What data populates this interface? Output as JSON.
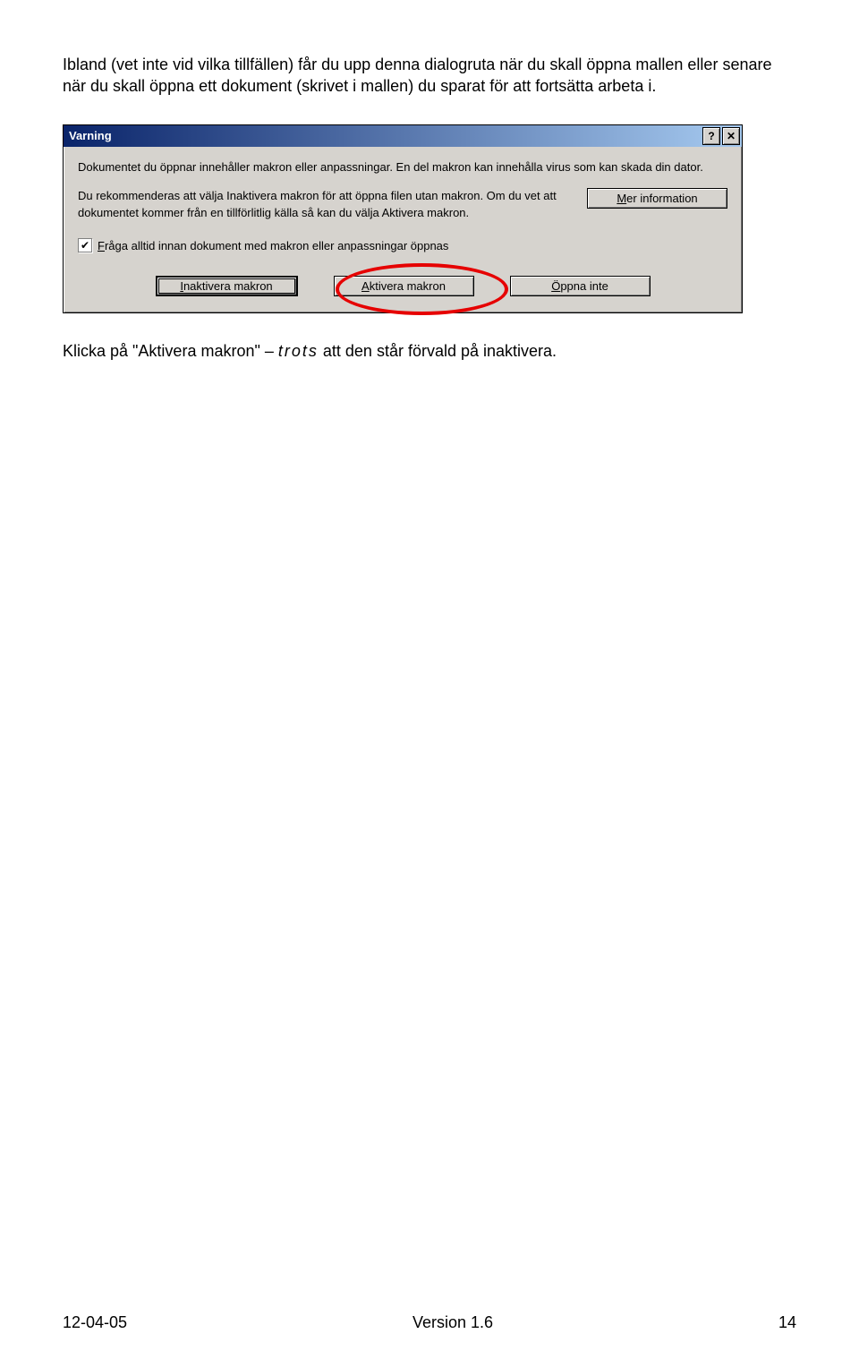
{
  "intro": "Ibland (vet inte vid vilka tillfällen) får du upp denna dialogruta när du skall öppna mallen eller senare när du skall öppna ett dokument (skrivet i mallen) du sparat för att fortsätta arbeta i.",
  "dialog": {
    "title": "Varning",
    "help_glyph": "?",
    "close_glyph": "✕",
    "para1": "Dokumentet du öppnar innehåller makron eller anpassningar. En del makron kan innehålla virus som kan skada din dator.",
    "para2": "Du rekommenderas att välja Inaktivera makron för att öppna filen utan makron. Om du vet att dokumentet kommer från en tillförlitlig källa så kan du välja Aktivera makron.",
    "more_info": "Mer information",
    "checkbox_check": "✔",
    "checkbox_label": "Fråga alltid innan dokument med makron eller anpassningar öppnas",
    "btn_disable": "Inaktivera makron",
    "btn_enable": "Aktivera makron",
    "btn_dont_open": "Öppna inte"
  },
  "outro_pre": "Klicka på \"Aktivera makron\" – ",
  "outro_em": "trots",
  "outro_post": " att den står förvald på inaktivera.",
  "footer": {
    "left": "12-04-05",
    "center": "Version 1.6",
    "right": "14"
  }
}
